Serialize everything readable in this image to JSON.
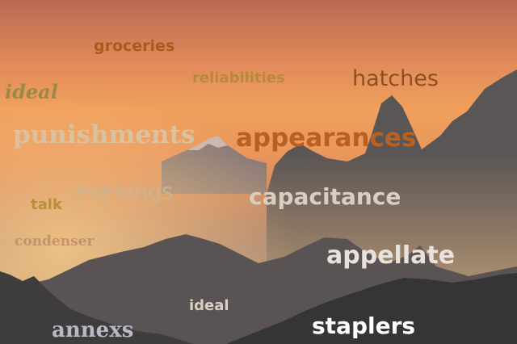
{
  "image": {
    "scene": "mountain peaks in haze at sunset",
    "palette": {
      "sky_top": "#b96a52",
      "sky_glow": "#f0a05c",
      "haze": "#c6835f",
      "ridge_far": "#7c6c6a",
      "ridge_mid": "#5a5454",
      "ridge_near": "#3d3b3d"
    }
  },
  "words": {
    "groceries": "groceries",
    "reliabilities": "reliabilities",
    "hatches": "hatches",
    "ideal_top": "ideal",
    "punishments": "punishments",
    "appearances": "appearances",
    "evenings": "evenings",
    "talk": "talk",
    "capacitance": "capacitance",
    "condenser": "condenser",
    "appellate": "appellate",
    "ideal_bottom": "ideal",
    "annexs": "annexs",
    "staplers": "staplers"
  }
}
